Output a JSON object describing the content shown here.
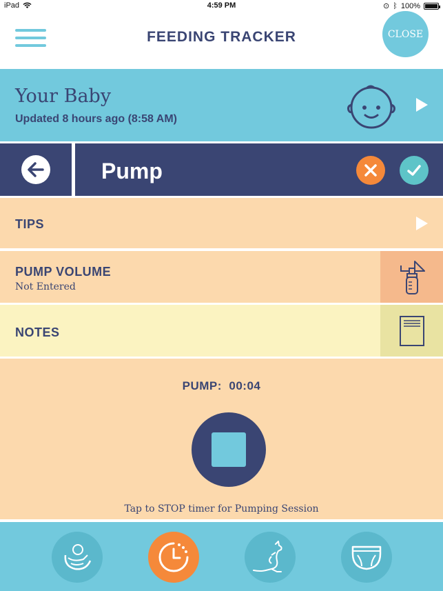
{
  "status_bar": {
    "device": "iPad",
    "time": "4:59 PM",
    "battery": "100%"
  },
  "header": {
    "title": "FEEDING TRACKER",
    "close_label": "CLOSE"
  },
  "baby": {
    "name": "Your Baby",
    "updated": "Updated 8 hours ago (8:58 AM)"
  },
  "activity": {
    "title": "Pump"
  },
  "rows": {
    "tips_label": "TIPS",
    "volume_label": "PUMP VOLUME",
    "volume_value": "Not Entered",
    "notes_label": "NOTES"
  },
  "timer": {
    "label": "PUMP:",
    "value": "00:04",
    "hint": "Tap to STOP timer for Pumping Session"
  },
  "bottom_nav": {
    "items": [
      {
        "icon": "baby-nursing-icon",
        "active": false
      },
      {
        "icon": "timer-icon",
        "active": true
      },
      {
        "icon": "kangaroo-icon",
        "active": false
      },
      {
        "icon": "diaper-icon",
        "active": false
      }
    ]
  },
  "colors": {
    "navy": "#3a4573",
    "sky": "#72c9dd",
    "peach": "#fcd9ad",
    "cream": "#fbf3c1",
    "orange": "#f5893a",
    "teal_button": "#5ec4c8",
    "nav_circle": "#5bb8cc"
  }
}
